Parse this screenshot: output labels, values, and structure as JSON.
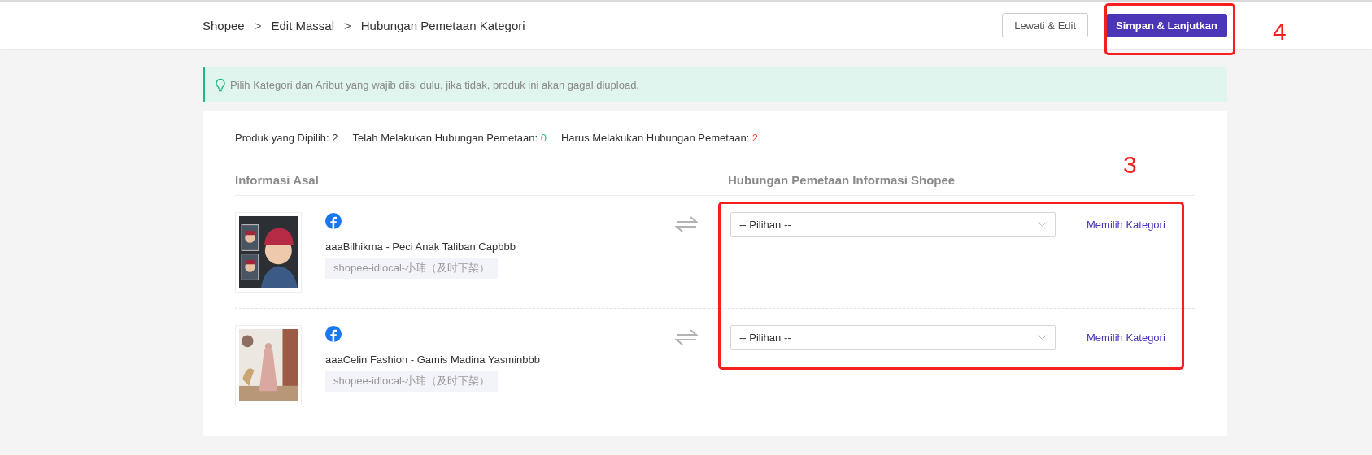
{
  "breadcrumb": [
    "Shopee",
    "Edit Massal",
    "Hubungan Pemetaan Kategori"
  ],
  "breadcrumb_separator": ">",
  "buttons": [
    {
      "label": "Lewati & Edit",
      "kind": "secondary"
    },
    {
      "label": "Simpan & Lanjutkan",
      "kind": "primary"
    }
  ],
  "notice": "Pilih Kategori dan Aribut yang wajib diisi dulu, jika tidak, produk ini akan gagal diupload.",
  "stats": [
    {
      "label": "Produk yang Dipilih:",
      "value": "2",
      "kind": "total"
    },
    {
      "label": "Telah Melakukan Hubungan Pemetaan:",
      "value": "0",
      "kind": "done"
    },
    {
      "label": "Harus Melakukan Hubungan Pemetaan:",
      "value": "2",
      "kind": "pending"
    }
  ],
  "columns": [
    "Informasi Asal",
    "Hubungan Pemetaan Informasi Shopee"
  ],
  "rows": [
    {
      "title": "aaaBilhikma - Peci Anak Taliban Capbbb",
      "store": "shopee-idlocal-小玮（及时下架）",
      "select_placeholder": "-- Pilihan --",
      "link": "Memilih Kategori"
    },
    {
      "title": "aaaCelin Fashion - Gamis Madina Yasminbbb",
      "store": "shopee-idlocal-小玮（及时下架）",
      "select_placeholder": "-- Pilihan --",
      "link": "Memilih Kategori"
    }
  ],
  "annotations": [
    {
      "label": "4"
    },
    {
      "label": "3"
    }
  ]
}
